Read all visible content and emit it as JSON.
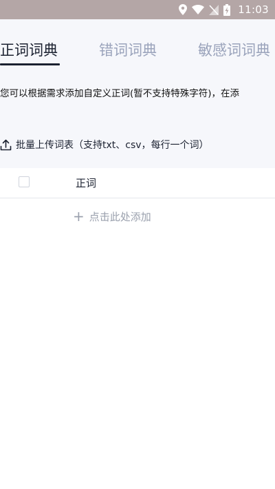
{
  "status_bar": {
    "time": "11:03"
  },
  "tabs": [
    {
      "label": "正词词典",
      "active": true
    },
    {
      "label": "错词词典",
      "active": false
    },
    {
      "label": "敏感词词典",
      "active": false
    }
  ],
  "notice": "您可以根据需求添加自定义正词(暂不支持特殊字符)，在添",
  "upload": {
    "label": "批量上传词表（支持txt、csv，每行一个词）"
  },
  "table": {
    "column_header": "正词"
  },
  "add_row": {
    "label": "点击此处添加"
  },
  "colors": {
    "status_bar_bg": "#b4a6a6",
    "top_area_bg": "#f6f7fb",
    "active_tab": "#1b2130",
    "inactive_tab": "#9aa3bb",
    "add_text": "#9aa0ad"
  }
}
